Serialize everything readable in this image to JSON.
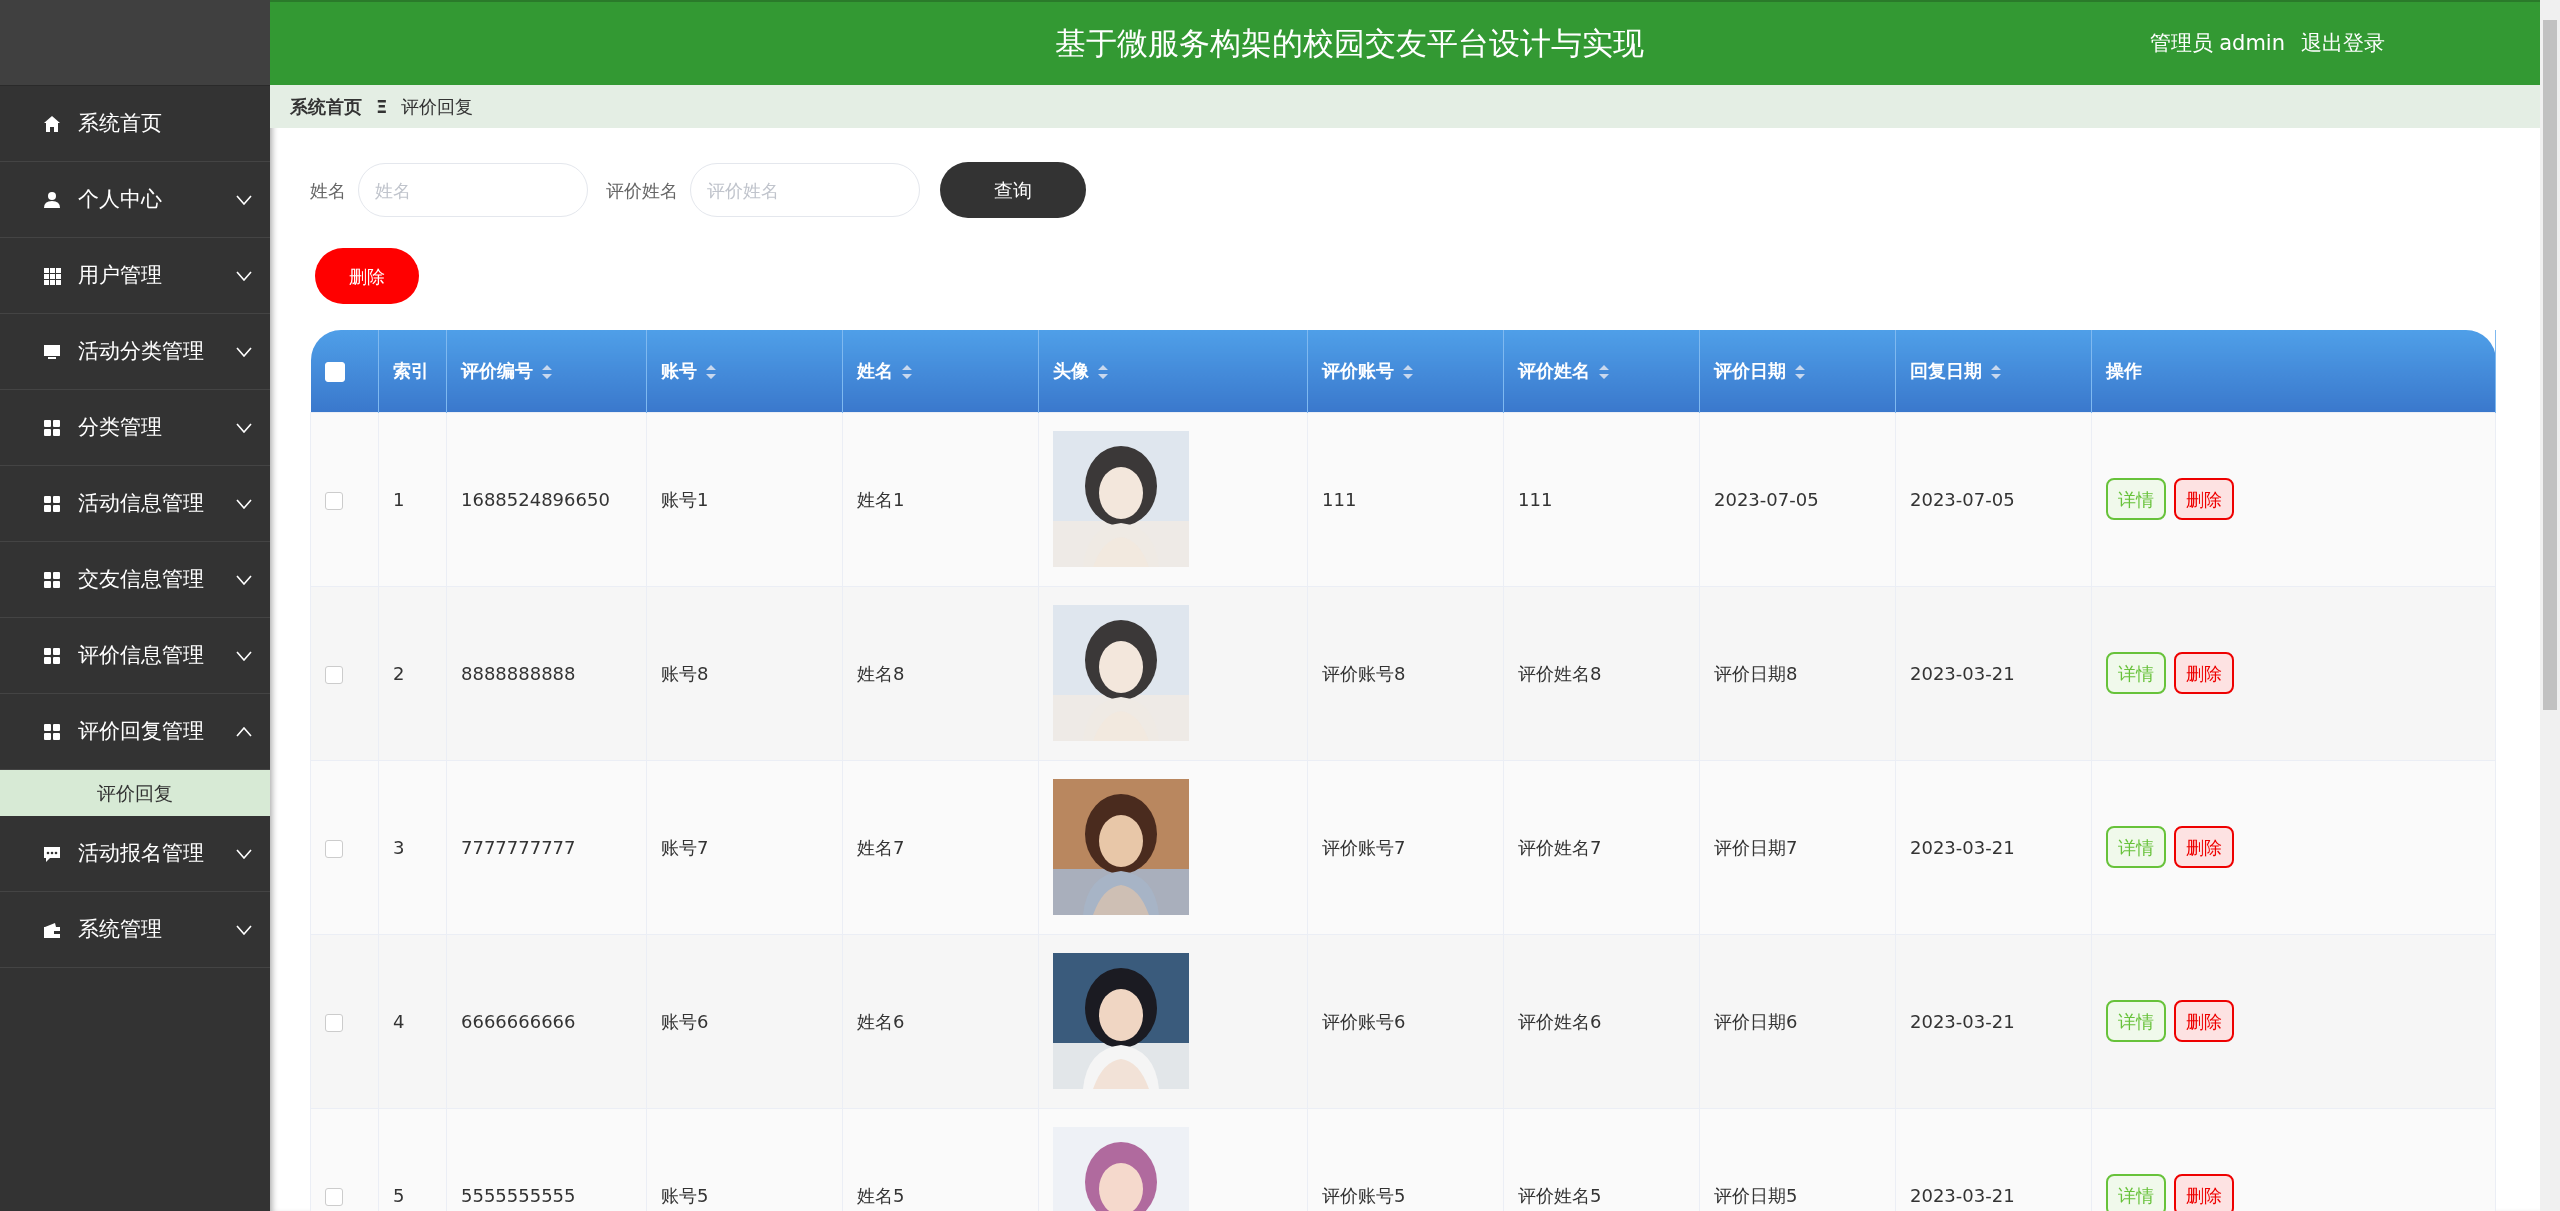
{
  "sidebar": {
    "items": [
      {
        "label": "系统首页"
      },
      {
        "label": "个人中心",
        "expanded": false
      },
      {
        "label": "用户管理",
        "expanded": false
      },
      {
        "label": "活动分类管理",
        "expanded": false
      },
      {
        "label": "分类管理",
        "expanded": false
      },
      {
        "label": "活动信息管理",
        "expanded": false
      },
      {
        "label": "交友信息管理",
        "expanded": false
      },
      {
        "label": "评价信息管理",
        "expanded": false
      },
      {
        "label": "评价回复管理",
        "expanded": true,
        "children": [
          {
            "label": "评价回复",
            "selected": true
          }
        ]
      },
      {
        "label": "活动报名管理",
        "expanded": false
      },
      {
        "label": "系统管理",
        "expanded": false
      }
    ]
  },
  "header": {
    "title": "基于微服务构架的校园交友平台设计与实现",
    "user": "管理员 admin",
    "logout": "退出登录"
  },
  "breadcrumb": {
    "home": "系统首页",
    "separator": "Ξ",
    "current": "评价回复"
  },
  "search": {
    "fields": [
      {
        "label": "姓名",
        "placeholder": "姓名"
      },
      {
        "label": "评价姓名",
        "placeholder": "评价姓名"
      }
    ],
    "button": "查询"
  },
  "delete_button": "删除",
  "table": {
    "select_all_checked": false,
    "columns": [
      {
        "label": "索引",
        "sortable": false
      },
      {
        "label": "评价编号",
        "sortable": true
      },
      {
        "label": "账号",
        "sortable": true
      },
      {
        "label": "姓名",
        "sortable": true
      },
      {
        "label": "头像",
        "sortable": true
      },
      {
        "label": "评价账号",
        "sortable": true
      },
      {
        "label": "评价姓名",
        "sortable": true
      },
      {
        "label": "评价日期",
        "sortable": true
      },
      {
        "label": "回复日期",
        "sortable": true
      },
      {
        "label": "操作",
        "sortable": false
      }
    ],
    "rows": [
      {
        "selected": false,
        "cells": [
          "1",
          "1688524896650",
          "账号1",
          "姓名1",
          {
            "kind": "picture"
          },
          "111",
          "111",
          "2023-07-05",
          "2023-07-05"
        ],
        "actions": [
          "详情",
          "删除"
        ]
      },
      {
        "selected": false,
        "cells": [
          "2",
          "8888888888",
          "账号8",
          "姓名8",
          {
            "kind": "picture"
          },
          "评价账号8",
          "评价姓名8",
          "评价日期8",
          "2023-03-21"
        ],
        "actions": [
          "详情",
          "删除"
        ]
      },
      {
        "selected": false,
        "cells": [
          "3",
          "7777777777",
          "账号7",
          "姓名7",
          {
            "kind": "picture"
          },
          "评价账号7",
          "评价姓名7",
          "评价日期7",
          "2023-03-21"
        ],
        "actions": [
          "详情",
          "删除"
        ]
      },
      {
        "selected": false,
        "cells": [
          "4",
          "6666666666",
          "账号6",
          "姓名6",
          {
            "kind": "picture"
          },
          "评价账号6",
          "评价姓名6",
          "评价日期6",
          "2023-03-21"
        ],
        "actions": [
          "详情",
          "删除"
        ]
      },
      {
        "selected": false,
        "cells": [
          "5",
          "5555555555",
          "账号5",
          "姓名5",
          {
            "kind": "picture"
          },
          "评价账号5",
          "评价姓名5",
          "评价日期5",
          "2023-03-21"
        ],
        "actions": [
          "详情",
          "删除"
        ]
      }
    ]
  }
}
